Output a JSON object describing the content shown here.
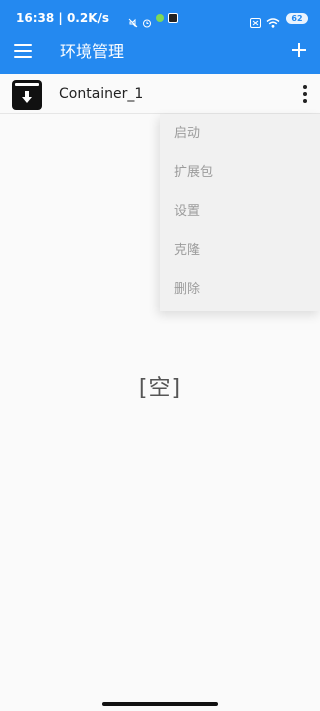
{
  "status_bar": {
    "time": "16:38",
    "speed": "0.2K/s",
    "battery": "62"
  },
  "app_bar": {
    "title": "环境管理",
    "menu_icon": "hamburger-menu-icon",
    "add_icon": "plus-icon"
  },
  "container": {
    "name": "Container_1",
    "icon": "archive-download-icon"
  },
  "menu": {
    "items": [
      "启动",
      "扩展包",
      "设置",
      "克隆",
      "删除"
    ]
  },
  "empty_label": "[空]",
  "colors": {
    "primary": "#2489f0",
    "background": "#fafafa",
    "menu_background": "#f1f1f1",
    "menu_text": "#9c9c9c"
  }
}
